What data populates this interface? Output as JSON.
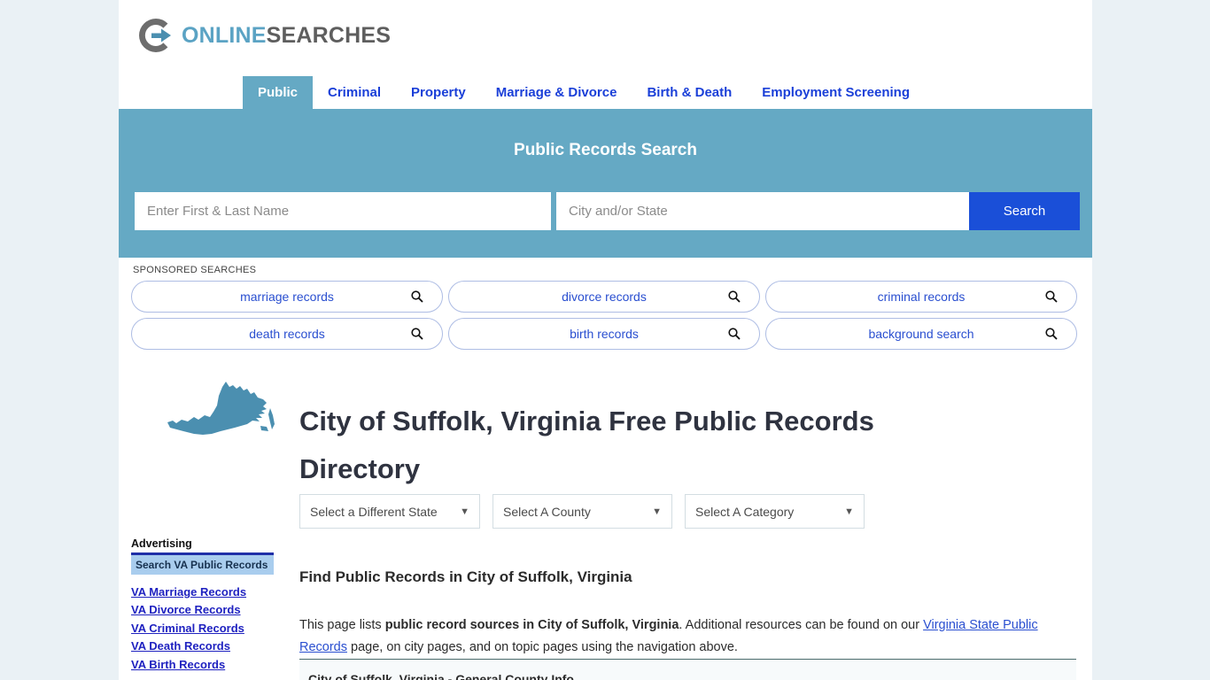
{
  "brand": {
    "logo_icon": "circle-arrow-logo-icon",
    "name_part1": "ONLINE",
    "name_part2": "SEARCHES",
    "accent_color": "#5ba3c4",
    "text_color": "#5e5e5e"
  },
  "nav": {
    "items": [
      {
        "label": "Public",
        "active": true
      },
      {
        "label": "Criminal",
        "active": false
      },
      {
        "label": "Property",
        "active": false
      },
      {
        "label": "Marriage & Divorce",
        "active": false
      },
      {
        "label": "Birth & Death",
        "active": false
      },
      {
        "label": "Employment Screening",
        "active": false
      }
    ],
    "active_bg": "#65a9c4",
    "link_color": "#1a3fd8"
  },
  "hero": {
    "title": "Public Records Search",
    "background_color": "#65a9c4",
    "name_placeholder": "Enter First & Last Name",
    "name_value": "",
    "city_placeholder": "City and/or State",
    "city_value": "",
    "search_label": "Search",
    "search_button_color": "#1a4fd8"
  },
  "sponsored": {
    "label": "SPONSORED SEARCHES",
    "icon": "magnifier-icon",
    "items": [
      {
        "label": "marriage records"
      },
      {
        "label": "divorce records"
      },
      {
        "label": "criminal records"
      },
      {
        "label": "death records"
      },
      {
        "label": "birth records"
      },
      {
        "label": "background search"
      }
    ]
  },
  "main": {
    "state_map_icon": "virginia-state-map-icon",
    "state_map_color": "#4b8fb0",
    "title": "City of Suffolk, Virginia Free Public Records Directory",
    "selects": [
      {
        "value": "Select a Different State",
        "caret": "▼"
      },
      {
        "value": "Select A County",
        "caret": "▼"
      },
      {
        "value": "Select A Category",
        "caret": "▼"
      }
    ],
    "section_heading": "Find Public Records in City of Suffolk, Virginia",
    "paragraph": {
      "part1": "This page lists ",
      "bold1": "public record sources in City of Suffolk, Virginia",
      "part2": ". Additional resources can be found on our ",
      "link1": "Virginia State Public Records",
      "part3": " page, on city pages, and on topic pages using the navigation above."
    },
    "table_first_row": "City of Suffolk, Virginia - General County Info"
  },
  "sidebar": {
    "title": "Advertising",
    "cta_label": "Search VA Public Records",
    "links": [
      {
        "label": "VA Marriage Records"
      },
      {
        "label": "VA Divorce Records"
      },
      {
        "label": "VA Criminal Records"
      },
      {
        "label": "VA Death Records"
      },
      {
        "label": "VA Birth Records"
      }
    ]
  }
}
